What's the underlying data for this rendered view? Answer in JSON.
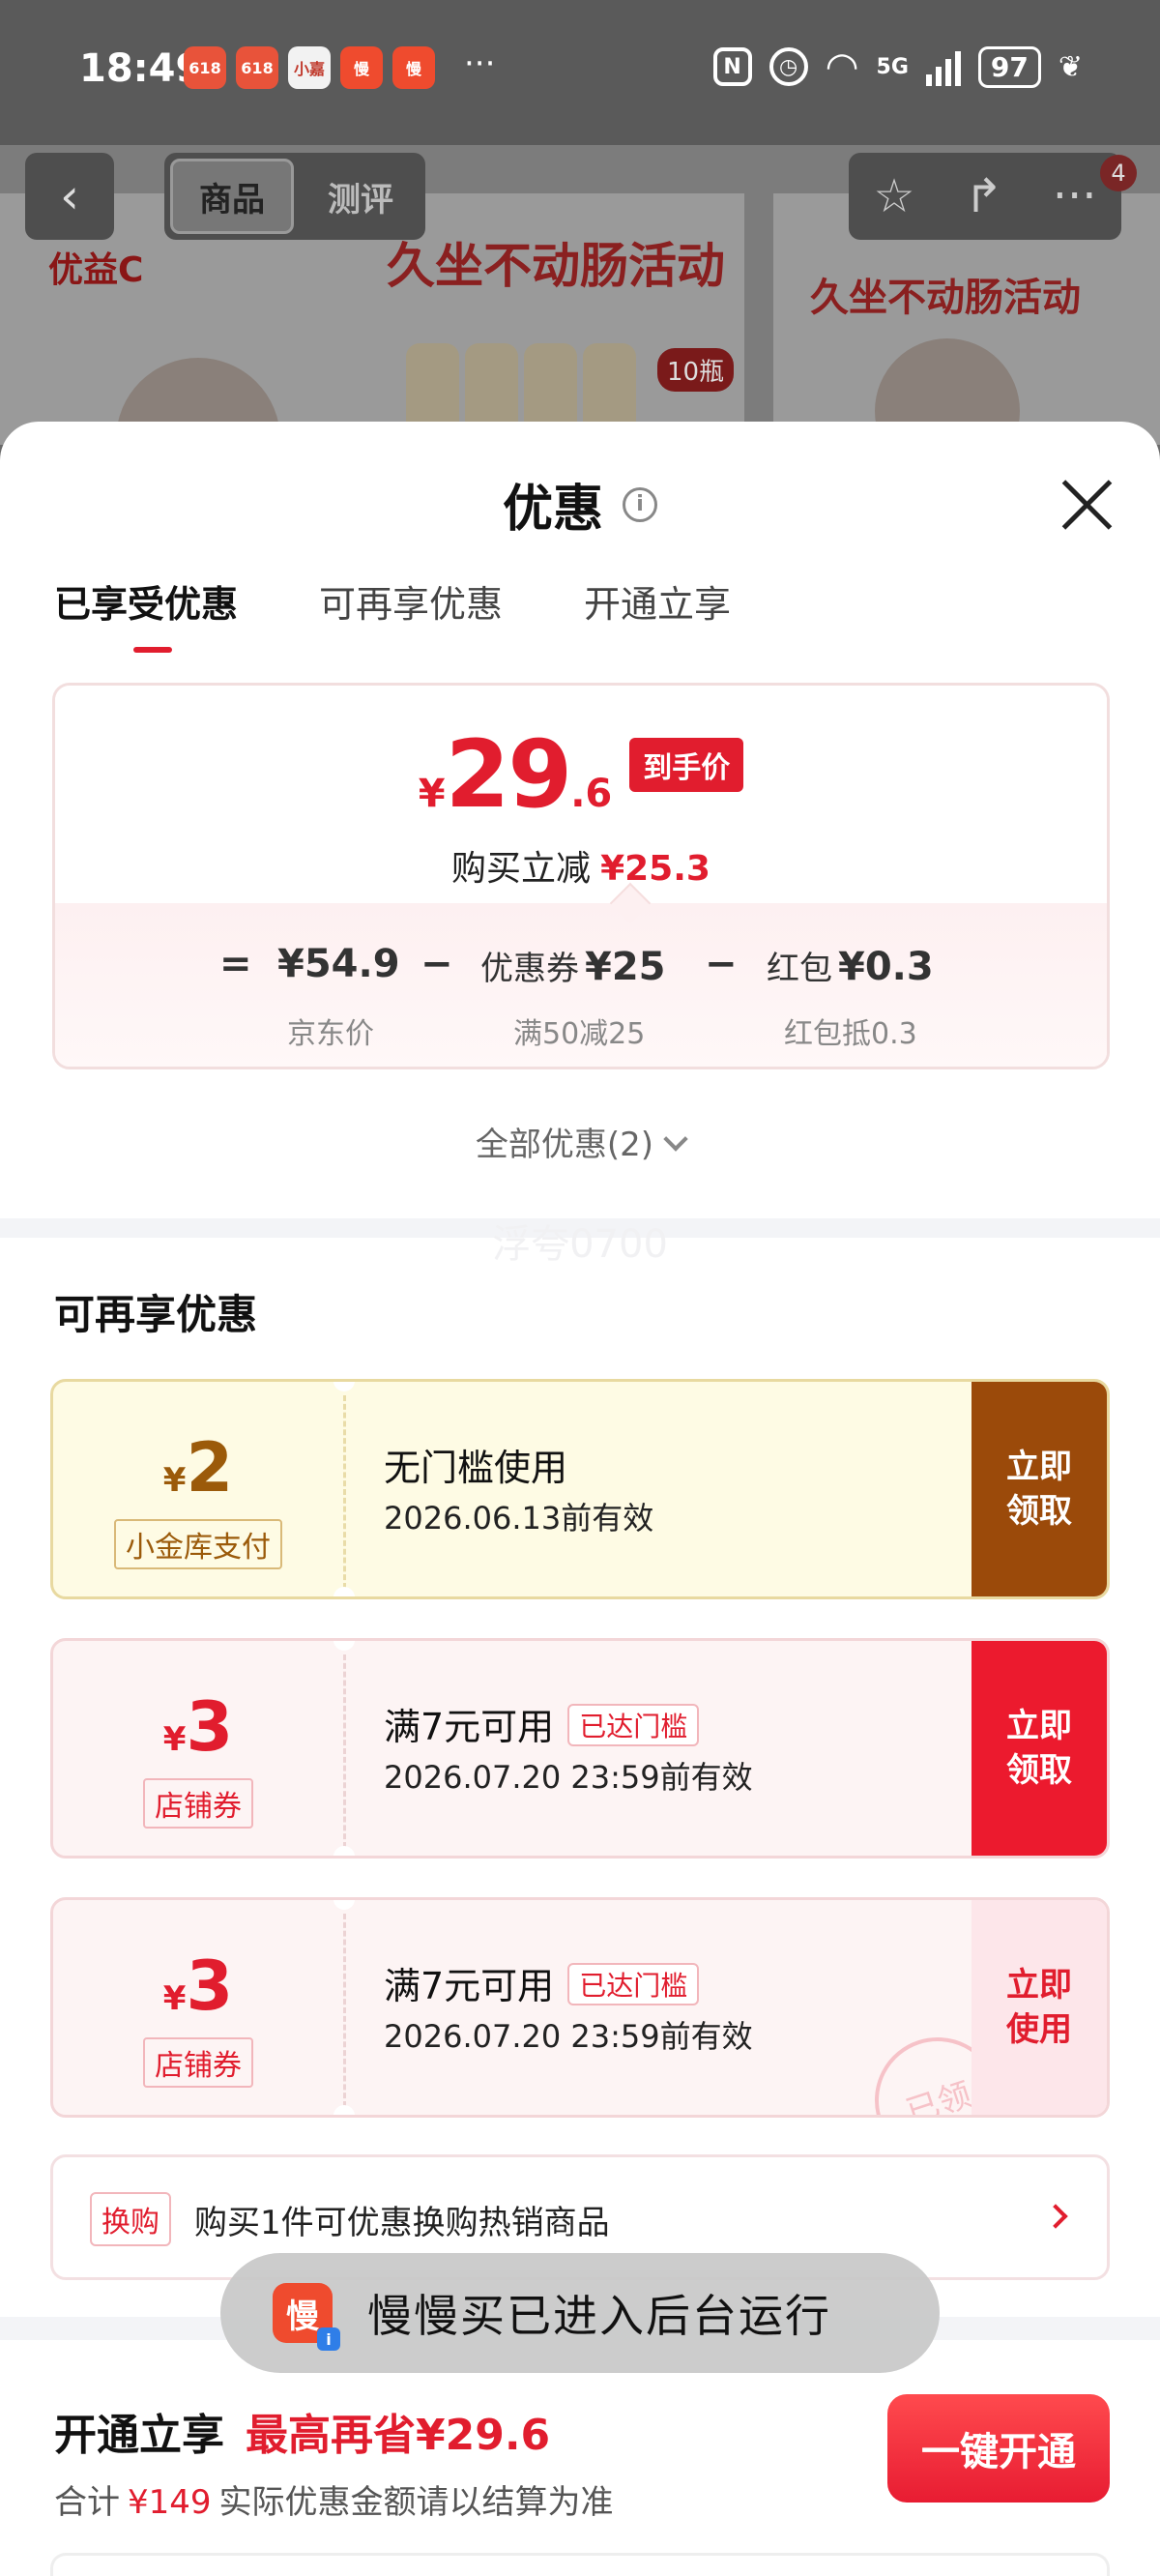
{
  "status_bar": {
    "time": "18:49",
    "apps": [
      "618",
      "618",
      "小嘉",
      "慢",
      "慢"
    ],
    "more": "···",
    "network": "5G",
    "battery": "97"
  },
  "header": {
    "tabs": [
      "商品",
      "测评"
    ],
    "badge": "4",
    "product_text": {
      "brand": "优益C",
      "headline": "久坐不动肠活动",
      "tag": "10瓶"
    }
  },
  "sheet": {
    "title": "优惠",
    "tabs": [
      "已享受优惠",
      "可再享优惠",
      "开通立享"
    ],
    "price_card": {
      "currency": "¥",
      "price_int": "29",
      "price_dec": ".6",
      "badge": "到手价",
      "reduce_label": "购买立减",
      "reduce_amount": "¥25.3",
      "eq": "=",
      "base_price": "¥54.9",
      "base_label": "京东价",
      "minus1": "−",
      "coupon_label": "优惠券",
      "coupon_value": "¥25",
      "coupon_sub": "满50减25",
      "minus2": "−",
      "redpack_label": "红包",
      "redpack_value": "¥0.3",
      "redpack_sub": "红包抵0.3"
    },
    "all_discounts": "全部优惠(2)",
    "watermark": "浮夸0700",
    "section_title": "可再享优惠",
    "coupons": [
      {
        "currency": "¥",
        "amount": "2",
        "label": "小金库支付",
        "title": "无门槛使用",
        "chip": "",
        "date": "2026.06.13前有效",
        "button": "立即\n领取",
        "button_l1": "立即",
        "button_l2": "领取"
      },
      {
        "currency": "¥",
        "amount": "3",
        "label": "店铺券",
        "title": "满7元可用",
        "chip": "已达门槛",
        "date": "2026.07.20 23:59前有效",
        "button_l1": "立即",
        "button_l2": "领取"
      },
      {
        "currency": "¥",
        "amount": "3",
        "label": "店铺券",
        "title": "满7元可用",
        "chip": "已达门槛",
        "date": "2026.07.20 23:59前有效",
        "button_l1": "立即",
        "button_l2": "使用",
        "stamp": "已领"
      }
    ],
    "swap": {
      "tag": "换购",
      "text": "购买1件可优惠换购热销商品"
    },
    "toast": {
      "icon": "慢",
      "text": "慢慢买已进入后台运行"
    },
    "membership": {
      "title": "开通立享",
      "max_label": "最高再省¥29.6",
      "sub_prefix": "合计",
      "sub_amount": "¥149",
      "sub_suffix": "实际优惠金额请以结算为准",
      "button": "一键开通"
    }
  }
}
